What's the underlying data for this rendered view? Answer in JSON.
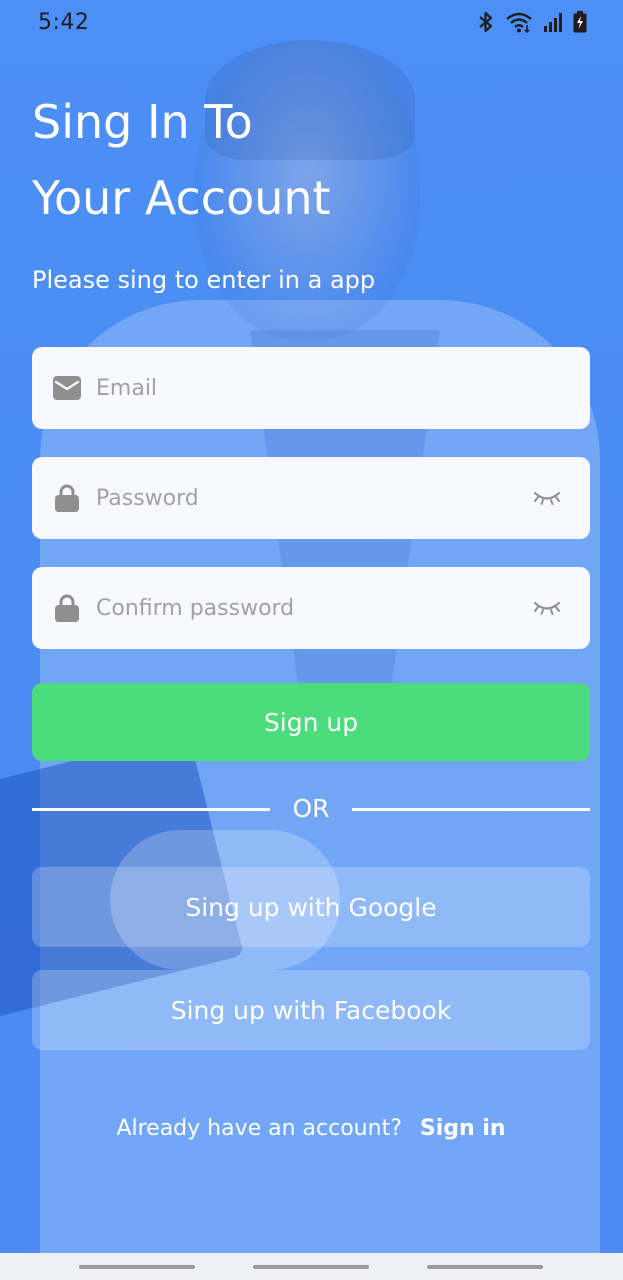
{
  "status_bar": {
    "time": "5:42",
    "icons": [
      "bluetooth-icon",
      "wifi-icon",
      "signal-icon",
      "battery-charging-icon"
    ]
  },
  "header": {
    "title_line1": "Sing In To",
    "title_line2": "Your Account",
    "subtitle": "Please sing to enter in a app"
  },
  "form": {
    "email": {
      "value": "",
      "placeholder": "Email",
      "icon": "mail-icon"
    },
    "password": {
      "value": "",
      "placeholder": "Password",
      "icon": "lock-icon",
      "toggle_icon": "eye-closed-icon"
    },
    "confirm_password": {
      "value": "",
      "placeholder": "Confirm password",
      "icon": "lock-icon",
      "toggle_icon": "eye-closed-icon"
    },
    "submit_label": "Sign up"
  },
  "divider": {
    "label": "OR"
  },
  "social": {
    "google_label": "Sing up with Google",
    "facebook_label": "Sing up with Facebook"
  },
  "footer": {
    "prompt": "Already have an account?",
    "link": "Sign in"
  },
  "colors": {
    "background": "#4b8cf5",
    "primary_button": "#4bdc7b",
    "field_background": "#f7f9fe",
    "text_on_background": "#ffffff",
    "placeholder": "#a2a2a2"
  }
}
